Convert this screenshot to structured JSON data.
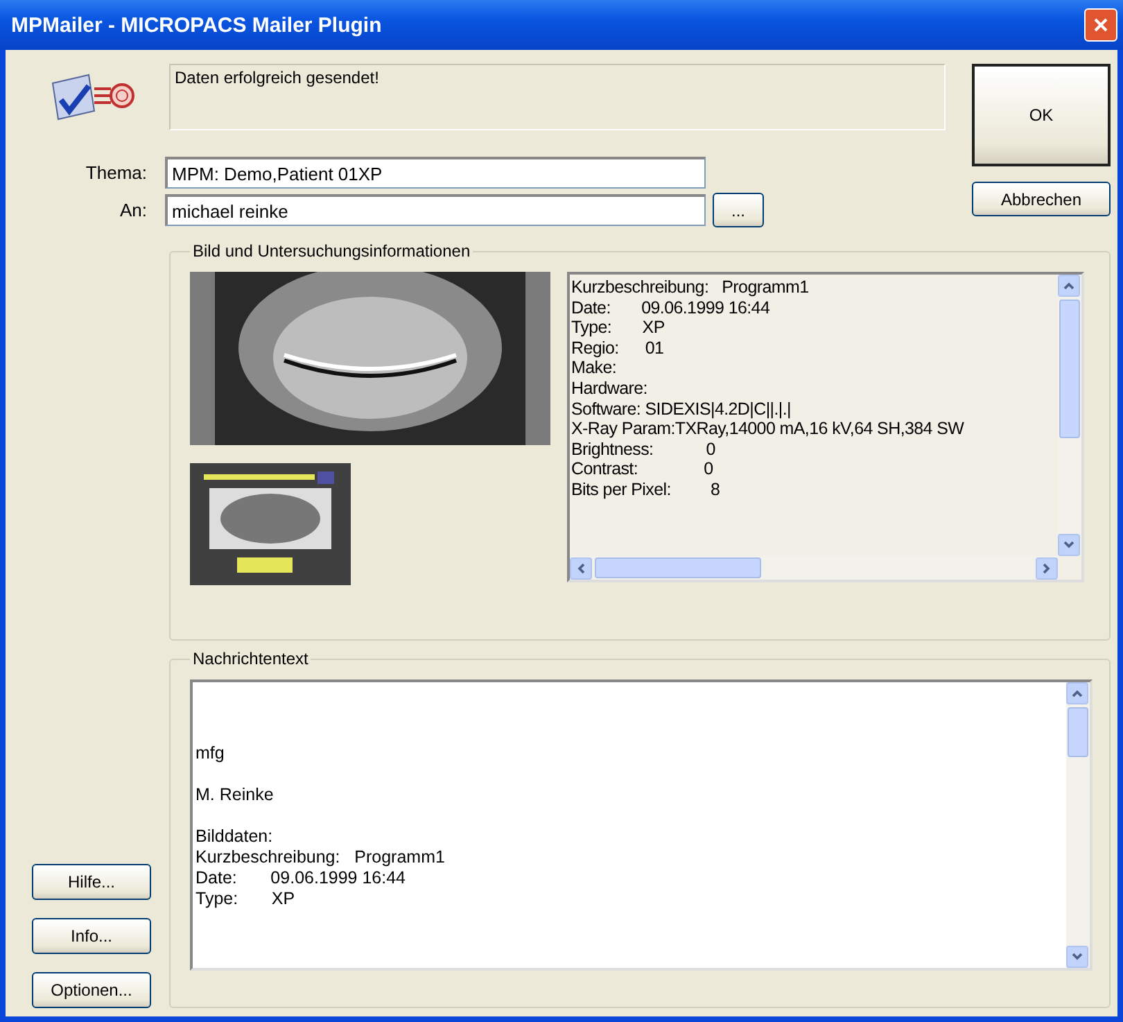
{
  "window": {
    "title": "MPMailer - MICROPACS Mailer Plugin"
  },
  "status_message": "Daten erfolgreich gesendet!",
  "fields": [
    {
      "label": "Thema:",
      "value": "MPM: Demo,Patient 01XP"
    },
    {
      "label": "An:",
      "value": "michael reinke",
      "browse": "..."
    }
  ],
  "buttons": {
    "ok": "OK",
    "cancel": "Abbrechen",
    "side": [
      "Hilfe...",
      "Info...",
      "Optionen..."
    ]
  },
  "image_group": {
    "title": "Bild und Untersuchungsinformationen",
    "info_lines": [
      "Kurzbeschreibung:   Programm1",
      "Date:       09.06.1999 16:44",
      "Type:       XP",
      "Regio:      01",
      "Make:",
      "Hardware:",
      "Software: SIDEXIS|4.2D|C||.|.|",
      "X-Ray Param:TXRay,14000 mA,16 kV,64 SH,384 SW",
      "Brightness:            0",
      "Contrast:               0",
      "Bits per Pixel:         8"
    ]
  },
  "message_group": {
    "title": "Nachrichtentext",
    "paragraphs": [
      [
        "mfg"
      ],
      [
        "M. Reinke"
      ],
      [
        "Bilddaten:",
        "Kurzbeschreibung:   Programm1",
        "Date:       09.06.1999 16:44",
        "Type:       XP"
      ]
    ]
  }
}
